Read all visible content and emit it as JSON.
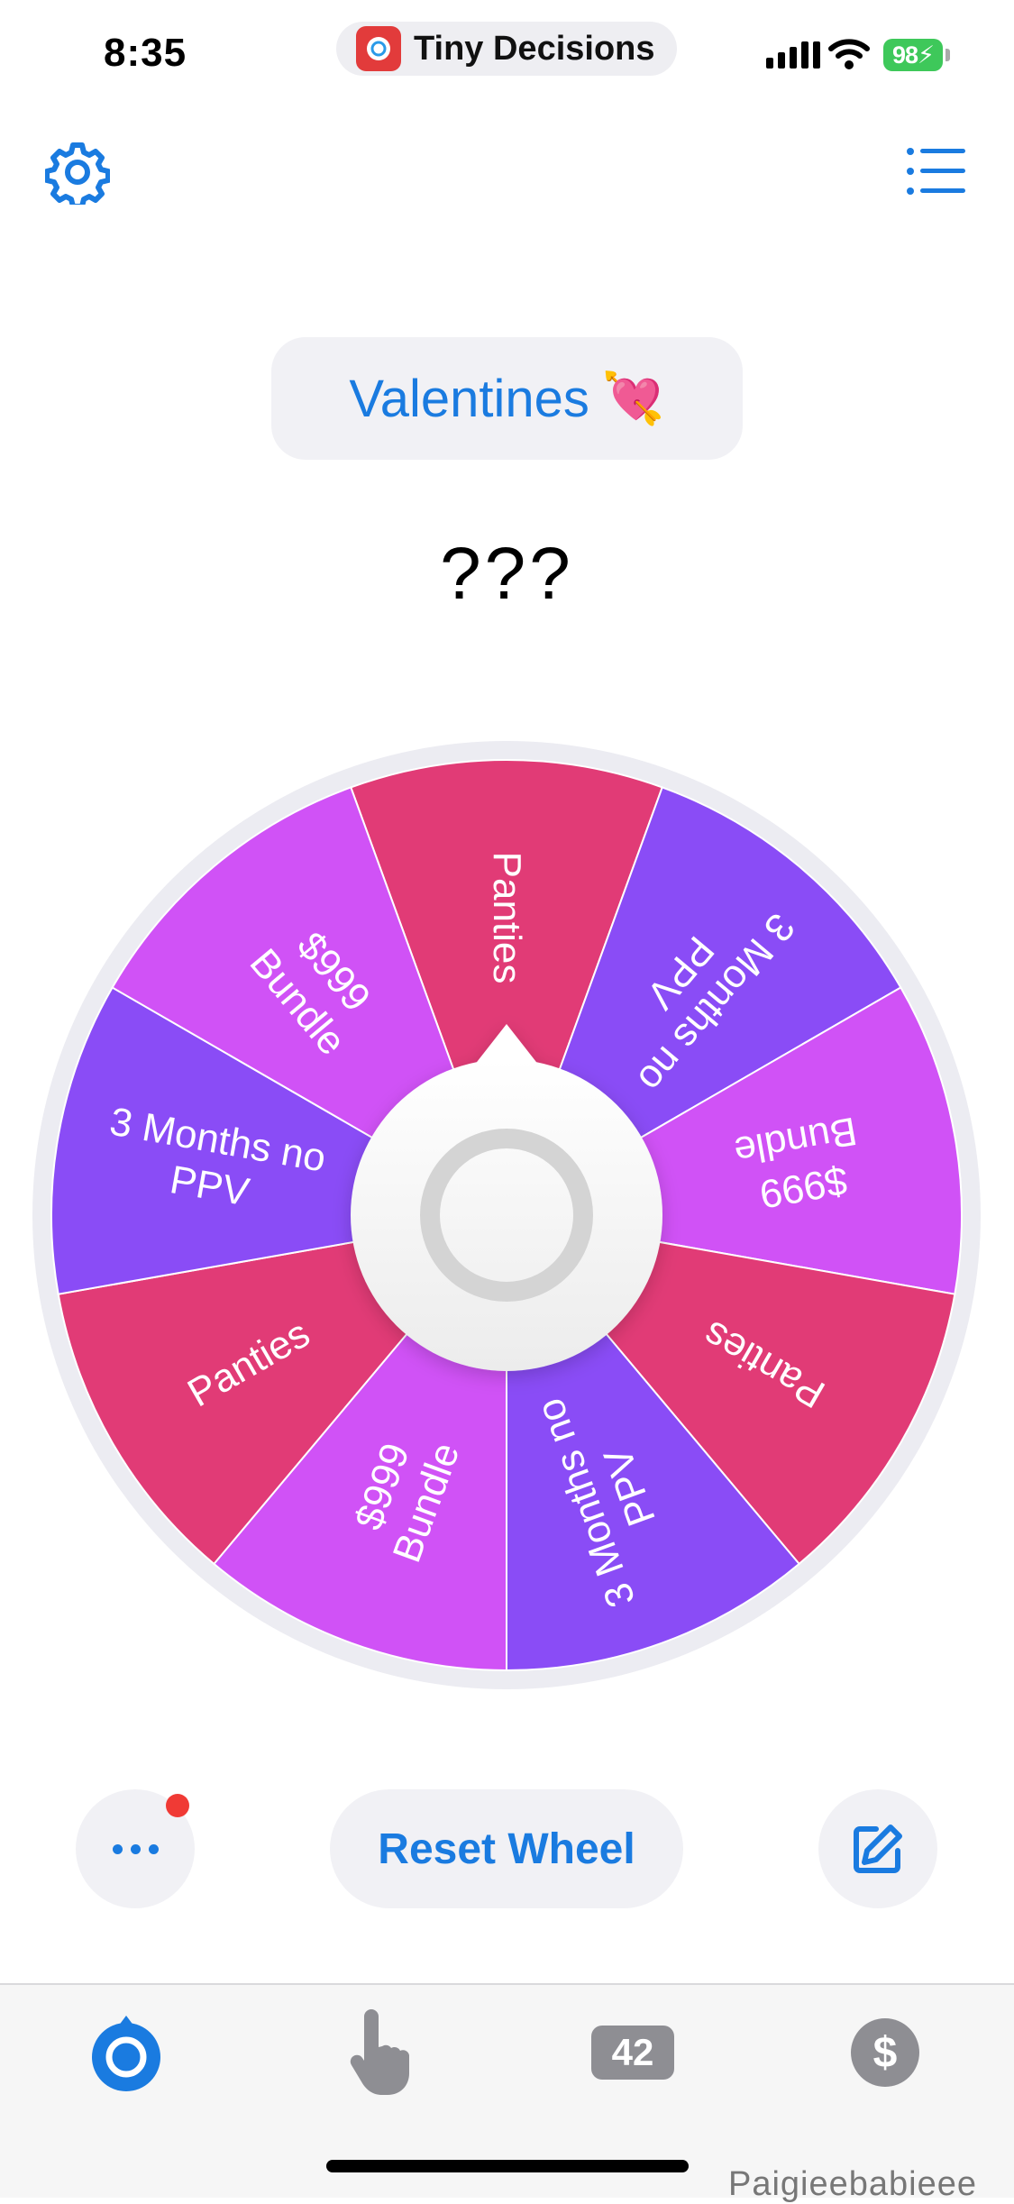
{
  "status_bar": {
    "time": "8:35",
    "app_name": "Tiny Decisions",
    "battery": "98"
  },
  "header": {
    "settings_icon": "gear-icon",
    "list_icon": "list-icon"
  },
  "wheel": {
    "title": "Valentines",
    "title_emoji": "💘",
    "result": "???",
    "segments": [
      {
        "label": "Panties",
        "color": "#e13b76"
      },
      {
        "label": "3 Months no PPV",
        "color": "#8a4cf6"
      },
      {
        "label": "$999 Bundle",
        "color": "#d052f6"
      },
      {
        "label": "Panties",
        "color": "#e13b76"
      },
      {
        "label": "3 Months no PPV",
        "color": "#8a4cf6"
      },
      {
        "label": "$999 Bundle",
        "color": "#d052f6"
      },
      {
        "label": "Panties",
        "color": "#e13b76"
      },
      {
        "label": "3 Months no PPV",
        "color": "#8a4cf6"
      },
      {
        "label": "$999 Bundle",
        "color": "#d052f6"
      }
    ]
  },
  "controls": {
    "reset_label": "Reset Wheel"
  },
  "tabbar": {
    "tabs": [
      {
        "name": "wheel-tab",
        "icon": "wheel-icon",
        "active": true
      },
      {
        "name": "finger-tab",
        "icon": "pointing-hand-icon"
      },
      {
        "name": "dice-tab",
        "badge": "42"
      },
      {
        "name": "premium-tab",
        "symbol": "$"
      }
    ]
  },
  "watermark": "Paigieebabieee",
  "colors": {
    "accent": "#1a7be0",
    "pink": "#e13b76",
    "violet": "#8a4cf6",
    "magenta": "#d052f6"
  }
}
